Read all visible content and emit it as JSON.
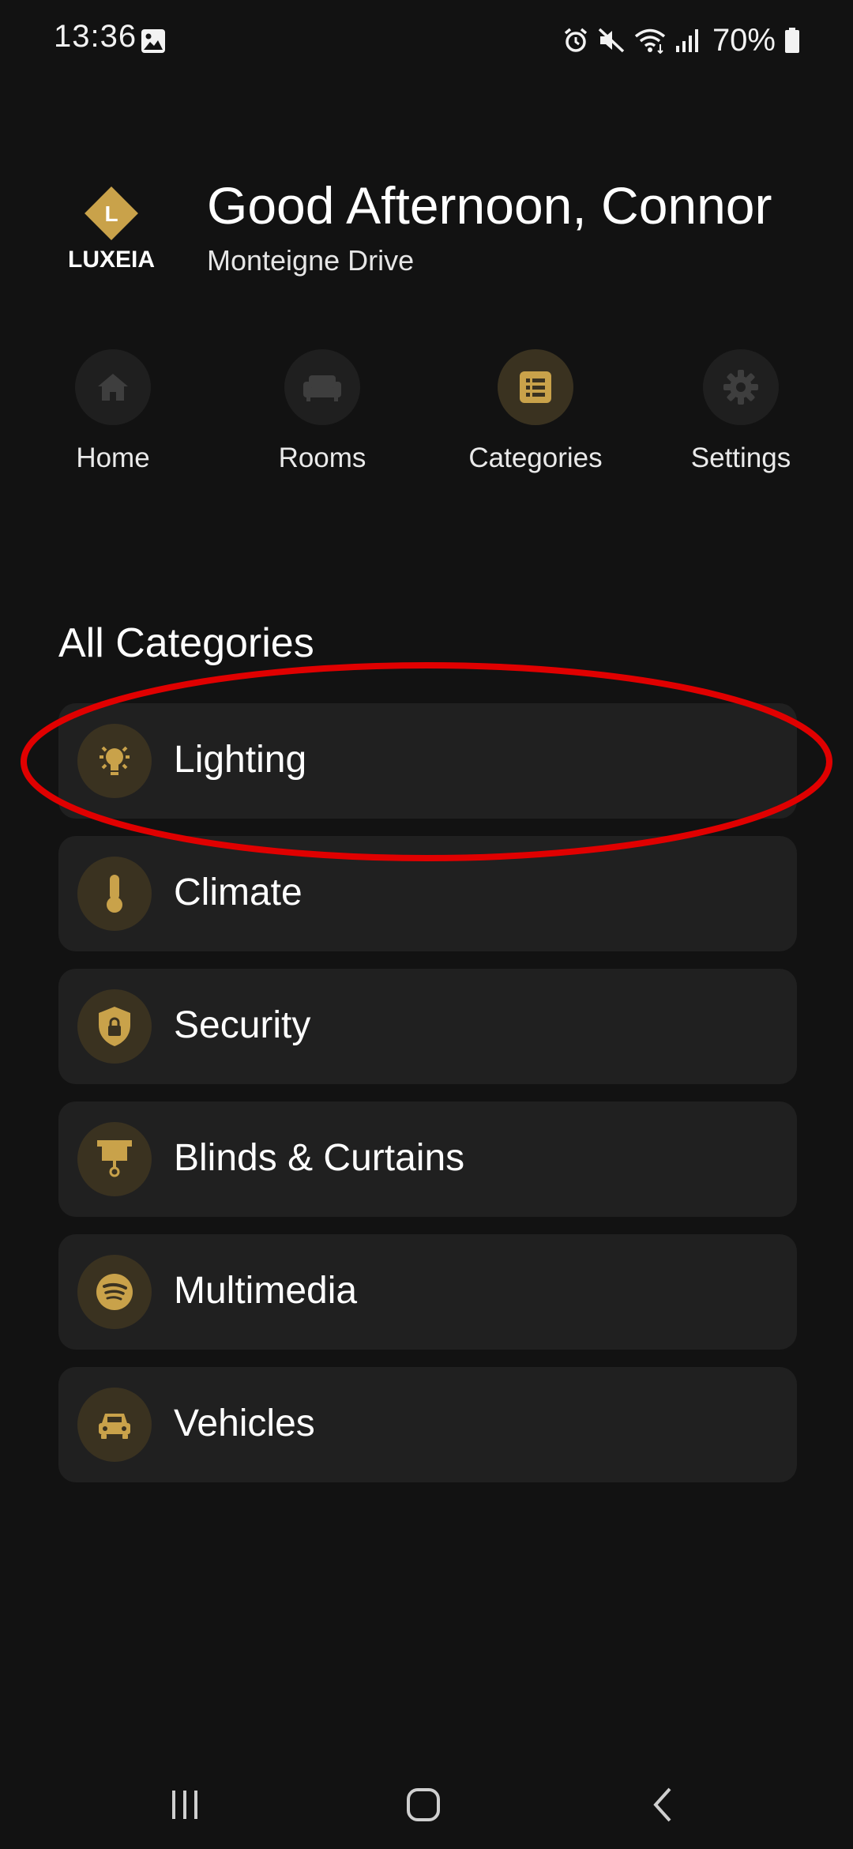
{
  "status_bar": {
    "time": "13:36",
    "battery_text": "70%",
    "icons": [
      "image-icon",
      "alarm-icon",
      "mute-icon",
      "wifi-icon",
      "signal-icon",
      "battery-icon"
    ]
  },
  "header": {
    "logo_text": "LUXEIA",
    "logo_letter": "L",
    "greeting": "Good Afternoon, Connor",
    "location": "Monteigne Drive"
  },
  "nav": {
    "items": [
      {
        "label": "Home",
        "icon": "home-icon",
        "active": false
      },
      {
        "label": "Rooms",
        "icon": "sofa-icon",
        "active": false
      },
      {
        "label": "Categories",
        "icon": "list-icon",
        "active": true
      },
      {
        "label": "Settings",
        "icon": "gear-icon",
        "active": false
      }
    ]
  },
  "section": {
    "title": "All Categories"
  },
  "categories": [
    {
      "label": "Lighting",
      "icon": "lightbulb-icon"
    },
    {
      "label": "Climate",
      "icon": "thermometer-icon"
    },
    {
      "label": "Security",
      "icon": "shield-lock-icon"
    },
    {
      "label": "Blinds & Curtains",
      "icon": "blinds-icon"
    },
    {
      "label": "Multimedia",
      "icon": "spotify-icon"
    },
    {
      "label": "Vehicles",
      "icon": "car-icon"
    }
  ],
  "colors": {
    "background": "#121212",
    "card": "#202020",
    "accent_gold": "#c9a24a",
    "icon_bg": "#3a3220",
    "annotation": "#e00000"
  }
}
